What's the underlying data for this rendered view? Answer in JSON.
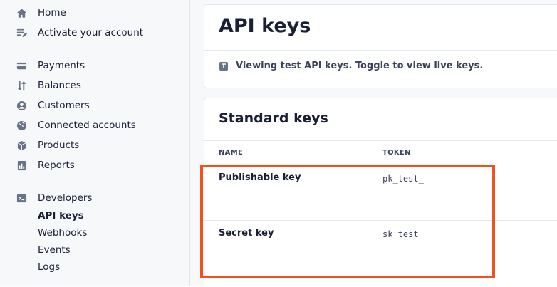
{
  "sidebar": {
    "top_items": [
      {
        "label": "Home",
        "icon": "home-icon"
      },
      {
        "label": "Activate your account",
        "icon": "edit-list-icon"
      }
    ],
    "main_items": [
      {
        "label": "Payments",
        "icon": "payments-icon"
      },
      {
        "label": "Balances",
        "icon": "balances-icon"
      },
      {
        "label": "Customers",
        "icon": "customers-icon"
      },
      {
        "label": "Connected accounts",
        "icon": "globe-icon"
      },
      {
        "label": "Products",
        "icon": "box-icon"
      },
      {
        "label": "Reports",
        "icon": "reports-icon"
      }
    ],
    "developers": {
      "label": "Developers",
      "icon": "terminal-icon",
      "sub_items": [
        "API keys",
        "Webhooks",
        "Events",
        "Logs"
      ],
      "active": "API keys"
    }
  },
  "header": {
    "title": "API keys",
    "notice": "Viewing test API keys. Toggle to view live keys."
  },
  "standard_keys": {
    "title": "Standard keys",
    "columns": [
      "NAME",
      "TOKEN"
    ],
    "rows": [
      {
        "name": "Publishable key",
        "token": "pk_test_"
      },
      {
        "name": "Secret key",
        "token": "sk_test_"
      }
    ]
  },
  "colors": {
    "highlight": "#f3501c",
    "sidebar_bg": "#f7f8fa",
    "text": "#1a1f36"
  }
}
